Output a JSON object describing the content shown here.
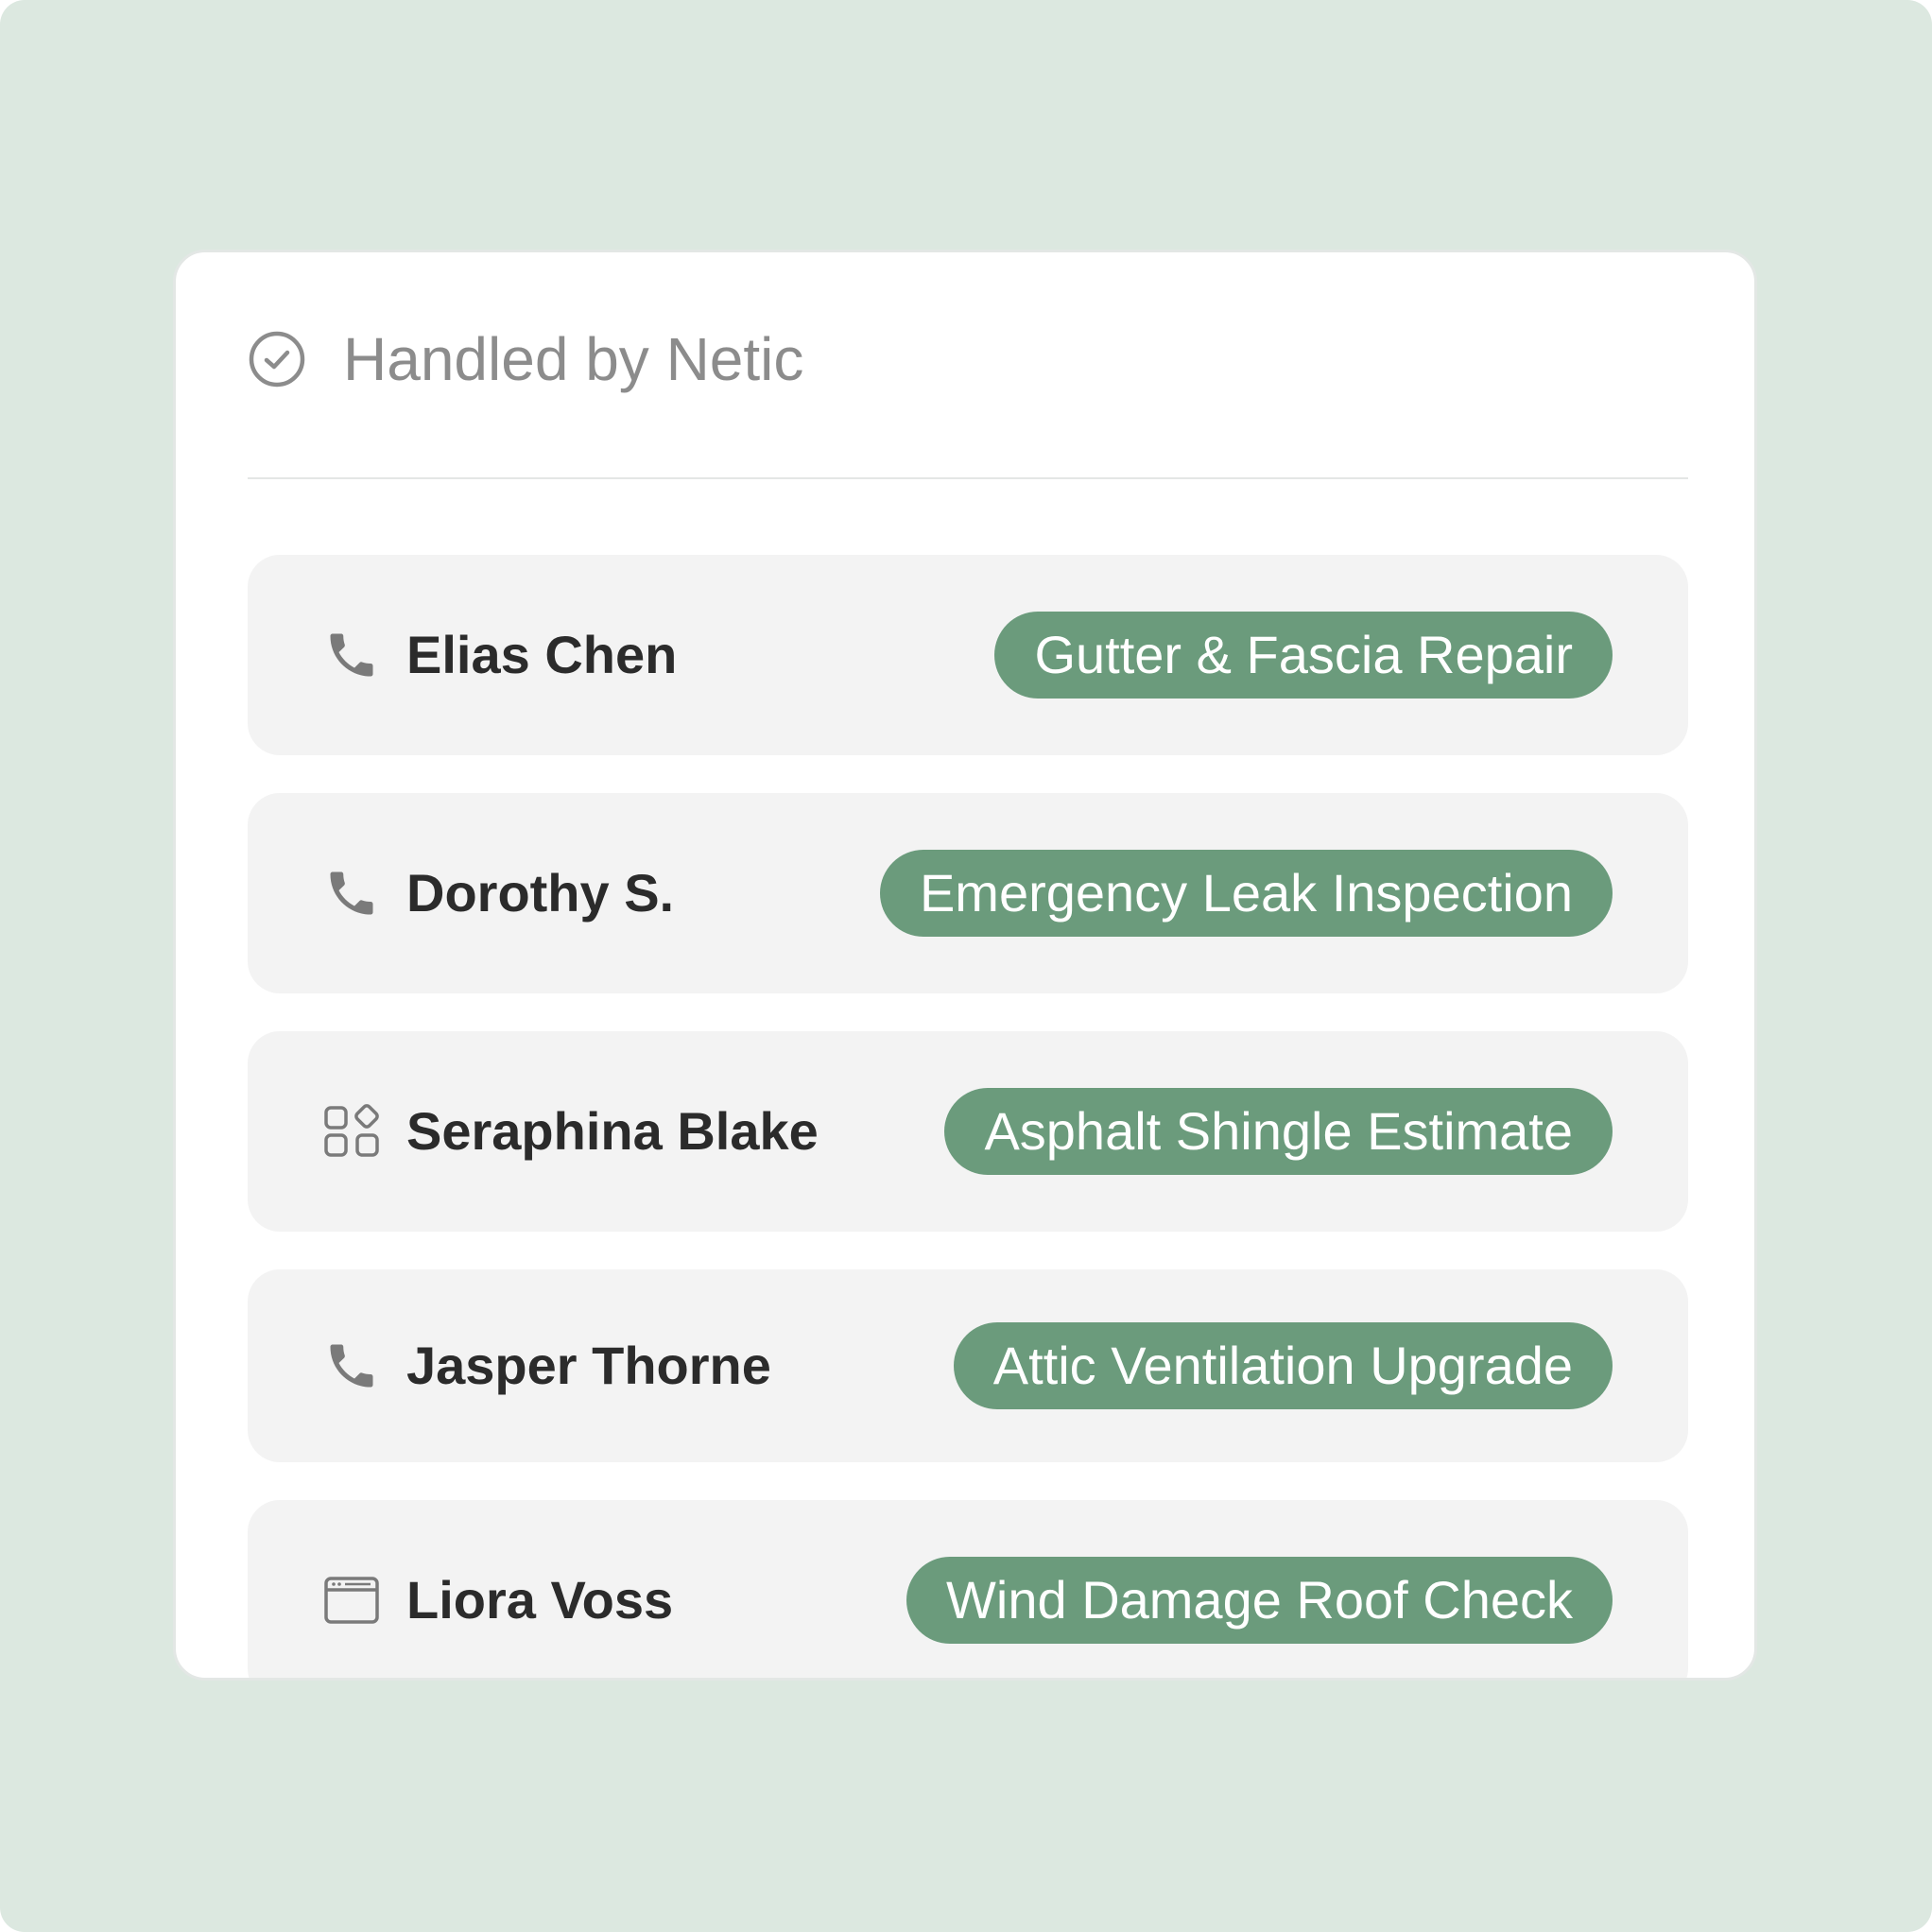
{
  "header": {
    "title": "Handled by Netic",
    "icon": "check-circle-icon"
  },
  "colors": {
    "background": "#dce8e0",
    "card": "#ffffff",
    "row_bg": "#f3f3f3",
    "pill_bg": "#6b9b7c",
    "pill_text": "#ffffff",
    "name_text": "#2b2b2b",
    "header_text": "#8c8c8c",
    "icon": "#7a7a7a"
  },
  "rows": [
    {
      "name": "Elias Chen",
      "service": "Gutter & Fascia Repair",
      "icon": "phone-icon"
    },
    {
      "name": "Dorothy S.",
      "service": "Emergency Leak Inspection",
      "icon": "phone-icon"
    },
    {
      "name": "Seraphina Blake",
      "service": "Asphalt Shingle Estimate",
      "icon": "apps-icon"
    },
    {
      "name": "Jasper Thorne",
      "service": "Attic Ventilation Upgrade",
      "icon": "phone-icon"
    },
    {
      "name": "Liora Voss",
      "service": "Wind Damage Roof Check",
      "icon": "browser-window-icon"
    }
  ]
}
